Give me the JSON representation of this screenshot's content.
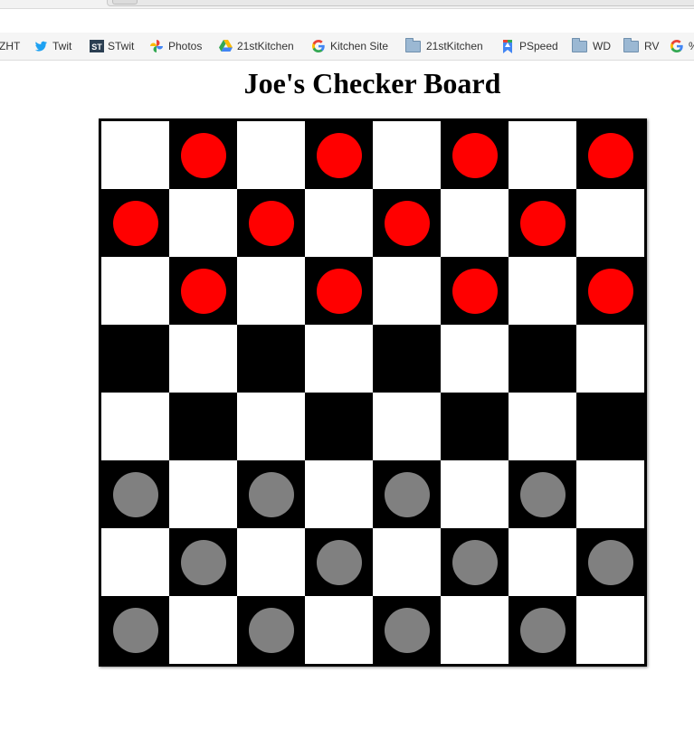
{
  "bookmarks": [
    {
      "label": "ZHT",
      "icon": "none"
    },
    {
      "label": "Twit",
      "icon": "twitter-bird-icon"
    },
    {
      "label": "STwit",
      "icon": "st-logo-icon"
    },
    {
      "label": "Photos",
      "icon": "photos-pinwheel-icon"
    },
    {
      "label": "21stKitchen",
      "icon": "google-drive-icon"
    },
    {
      "label": "Kitchen Site",
      "icon": "google-g-icon"
    },
    {
      "label": "21stKitchen",
      "icon": "folder-icon"
    },
    {
      "label": "PSpeed",
      "icon": "pagespeed-icon"
    },
    {
      "label": "WD",
      "icon": "folder-icon"
    },
    {
      "label": "RV",
      "icon": "folder-icon"
    },
    {
      "label": "%",
      "icon": "google-g-icon"
    }
  ],
  "title": "Joe's Checker Board",
  "board": {
    "size": 8,
    "colors": {
      "dark_square": "#000000",
      "light_square": "#ffffff",
      "red_piece": "#ff0000",
      "gray_piece": "#808080"
    },
    "rows": [
      [
        "",
        "red",
        "",
        "red",
        "",
        "red",
        "",
        "red"
      ],
      [
        "red",
        "",
        "red",
        "",
        "red",
        "",
        "red",
        ""
      ],
      [
        "",
        "red",
        "",
        "red",
        "",
        "red",
        "",
        "red"
      ],
      [
        "",
        "",
        "",
        "",
        "",
        "",
        "",
        ""
      ],
      [
        "",
        "",
        "",
        "",
        "",
        "",
        "",
        ""
      ],
      [
        "gray",
        "",
        "gray",
        "",
        "gray",
        "",
        "gray",
        ""
      ],
      [
        "",
        "gray",
        "",
        "gray",
        "",
        "gray",
        "",
        "gray"
      ],
      [
        "gray",
        "",
        "gray",
        "",
        "gray",
        "",
        "gray",
        ""
      ]
    ]
  }
}
